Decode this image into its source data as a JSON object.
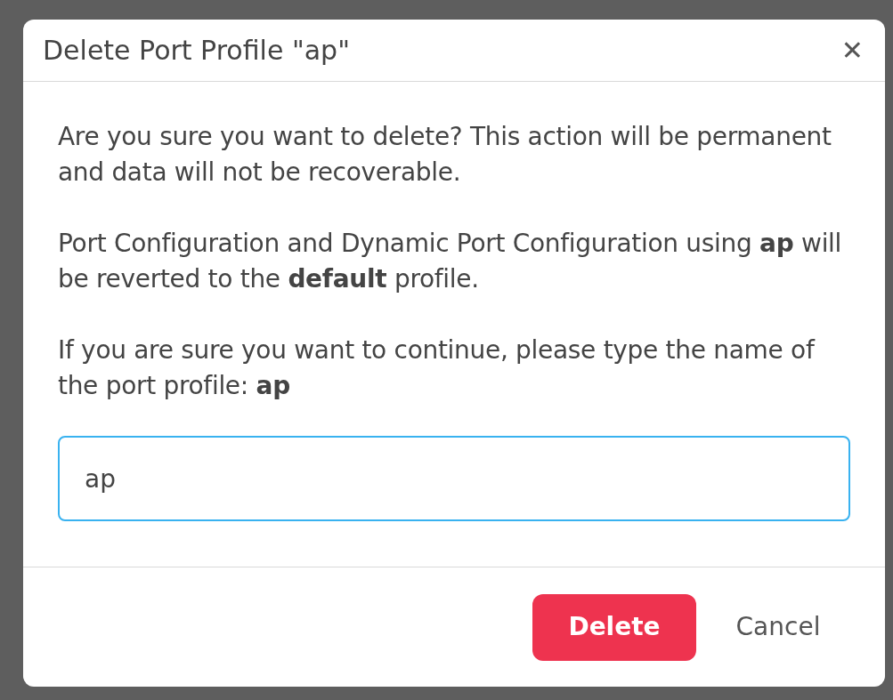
{
  "dialog": {
    "title": "Delete Port Profile \"ap\"",
    "close": "✕",
    "paragraphs": [
      "Are you sure you want to delete? This action will be permanent and data will not be recoverable.",
      "Port Configuration and Dynamic Port Configuration using **ap** will be reverted to the **default** profile.",
      "If you are sure you want to continue, please type the name of the port profile: **ap**"
    ],
    "input": {
      "value": "ap",
      "focused": true
    },
    "buttons": [
      {
        "label": "Delete",
        "kind": "danger"
      },
      {
        "label": "Cancel",
        "kind": "plain"
      }
    ]
  }
}
